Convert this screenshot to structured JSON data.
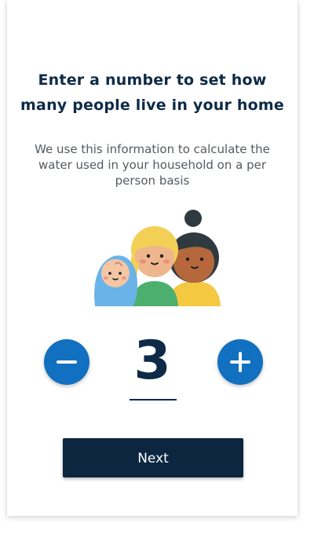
{
  "header": {
    "title_line1": "Enter a number to set how",
    "title_line2": "many people live in your home"
  },
  "description": {
    "line1": "We use this information to calculate the",
    "line2": "water used in your household on a per",
    "line3": "person basis"
  },
  "illustration": {
    "icon": "family-icon",
    "people": [
      "baby",
      "adult-blonde",
      "adult-bun"
    ]
  },
  "counter": {
    "value": "3",
    "decrement_icon": "minus-icon",
    "increment_icon": "plus-icon"
  },
  "actions": {
    "next_label": "Next"
  },
  "colors": {
    "primary_navy": "#0c2640",
    "accent_blue": "#1170c0",
    "text_gray": "#555a60"
  }
}
